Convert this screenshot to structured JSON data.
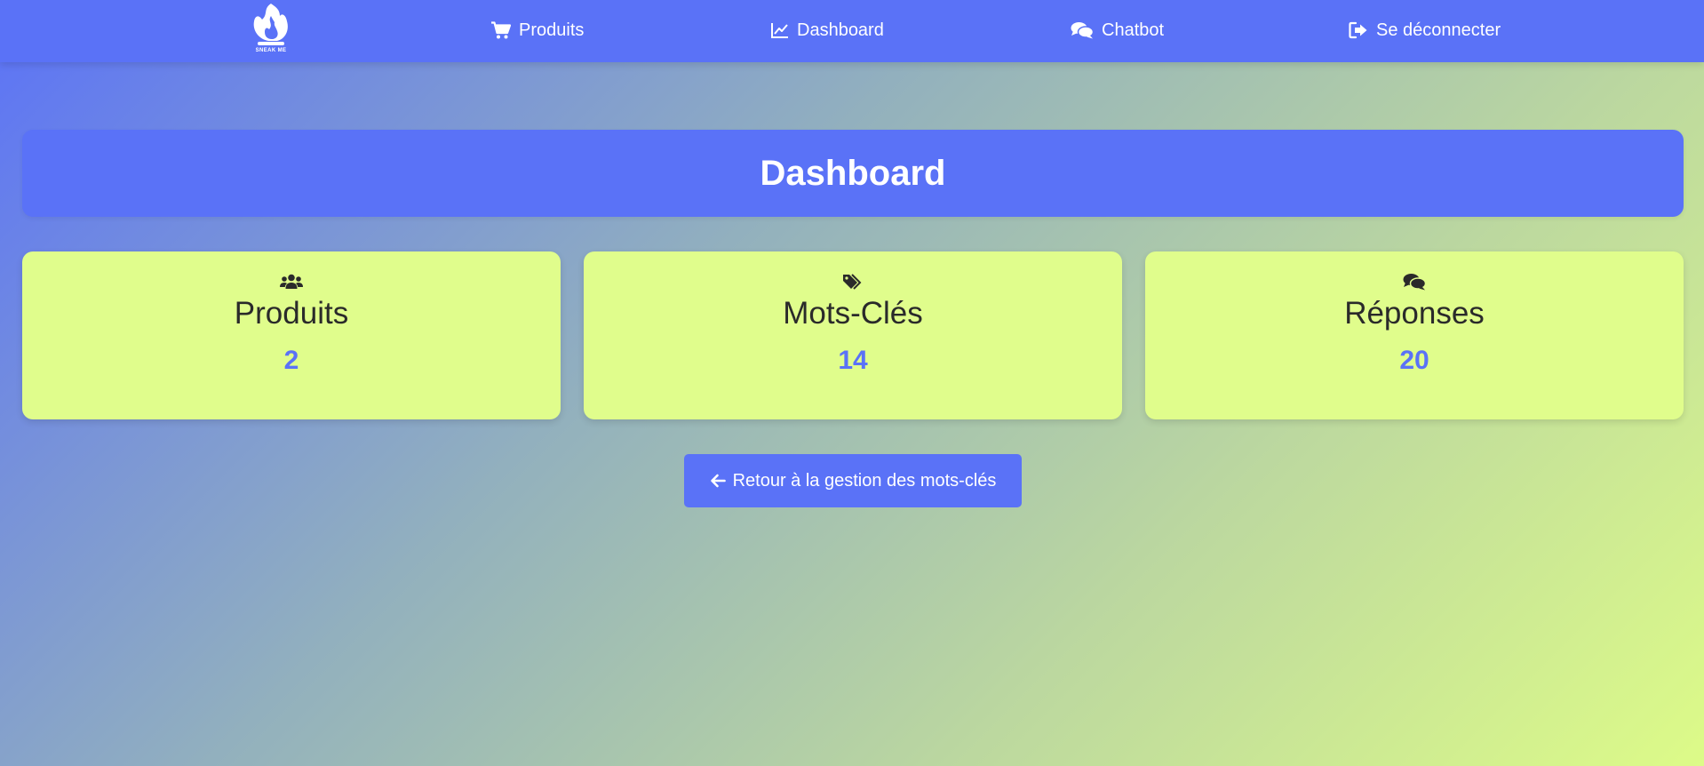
{
  "navbar": {
    "logo_text": "SNEAK ME",
    "items": [
      {
        "label": "Produits",
        "icon": "shopping-cart-icon"
      },
      {
        "label": "Dashboard",
        "icon": "line-chart-icon"
      },
      {
        "label": "Chatbot",
        "icon": "chat-bubbles-icon"
      },
      {
        "label": "Se déconnecter",
        "icon": "sign-out-icon"
      }
    ]
  },
  "header": {
    "title": "Dashboard"
  },
  "stats": [
    {
      "label": "Produits",
      "value": "2",
      "icon": "users-icon"
    },
    {
      "label": "Mots-Clés",
      "value": "14",
      "icon": "tags-icon"
    },
    {
      "label": "Réponses",
      "value": "20",
      "icon": "chat-bubbles-icon"
    }
  ],
  "back_button": {
    "label": "Retour à la gestion des mots-clés",
    "icon": "arrow-left-icon"
  },
  "colors": {
    "primary": "#5a72f7",
    "card": "#e0fd8c",
    "text_dark": "#2a2a2a",
    "gradient_end": "#ddfb88"
  }
}
